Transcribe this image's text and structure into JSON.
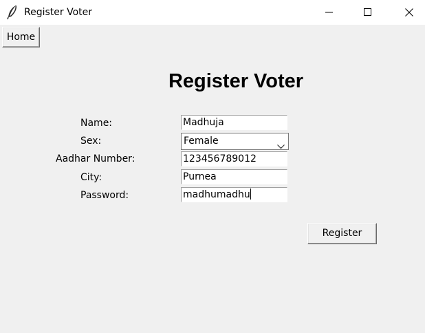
{
  "window": {
    "title": "Register Voter",
    "controls": [
      "minimize-icon",
      "maximize-icon",
      "close-icon"
    ]
  },
  "toolbar": {
    "home_label": "Home"
  },
  "form": {
    "heading": "Register Voter",
    "name_label": "Name:",
    "name_value": "Madhuja",
    "sex_label": "Sex:",
    "sex_value": "Female",
    "aadhar_label": "Aadhar Number:",
    "aadhar_value": "123456789012",
    "city_label": "City:",
    "city_value": "Purnea",
    "password_label": "Password:",
    "password_value": "madhumadhu",
    "register_label": "Register"
  }
}
